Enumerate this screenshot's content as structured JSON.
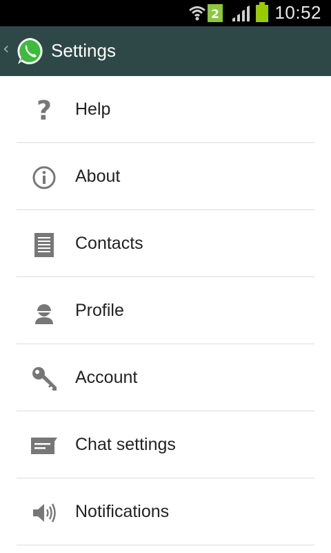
{
  "status_bar": {
    "time": "10:52",
    "sim_badge": "2"
  },
  "action_bar": {
    "title": "Settings",
    "app_icon": "whatsapp-logo-icon"
  },
  "settings": {
    "items": [
      {
        "label": "Help",
        "icon": "help-icon"
      },
      {
        "label": "About",
        "icon": "info-icon"
      },
      {
        "label": "Contacts",
        "icon": "contacts-list-icon"
      },
      {
        "label": "Profile",
        "icon": "profile-person-icon"
      },
      {
        "label": "Account",
        "icon": "key-icon"
      },
      {
        "label": "Chat settings",
        "icon": "chat-bubble-icon"
      },
      {
        "label": "Notifications",
        "icon": "speaker-icon"
      }
    ]
  },
  "colors": {
    "action_bar": "#2e4747",
    "status_bar": "#000000",
    "battery": "#99cc00",
    "icon_gray": "#777777"
  }
}
